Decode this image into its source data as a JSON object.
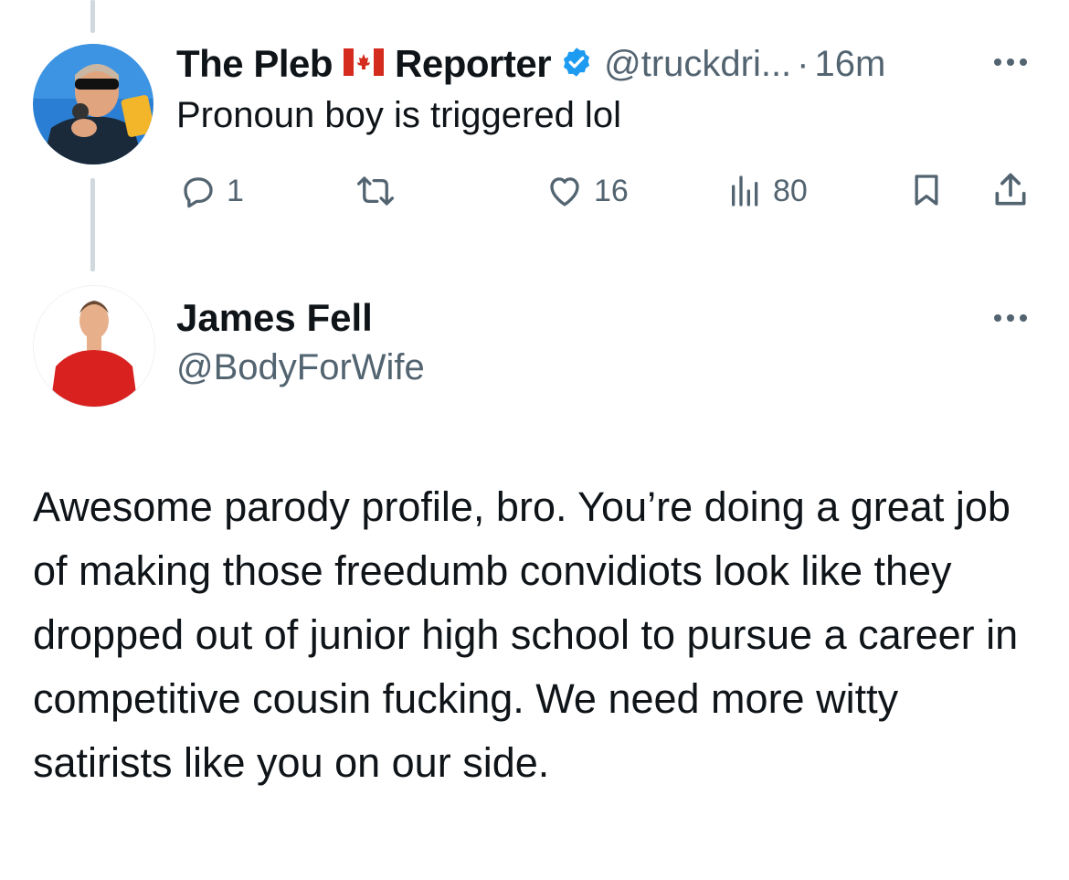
{
  "colors": {
    "text": "#0f1419",
    "muted": "#536471",
    "verified_blue": "#1d9bf0",
    "thread_line": "#cfd9de"
  },
  "parent_tweet": {
    "display_name_part1": "The Pleb",
    "flag_icon": "canada-flag-icon",
    "display_name_part2": "Reporter",
    "verified_icon": "verified-badge-icon",
    "handle": "@truckdri...",
    "separator": "·",
    "time": "16m",
    "text": "Pronoun boy is triggered lol",
    "actions": {
      "replies": "1",
      "reposts": "",
      "likes": "16",
      "views": "80"
    }
  },
  "reply_tweet": {
    "display_name": "James Fell",
    "handle": "@BodyForWife",
    "text": "Awesome parody profile, bro. You’re doing a great job of making those freedumb convidiots look like they dropped out of junior high school to pursue a career in competitive cousin fucking. We need more witty satirists like you on our side."
  }
}
